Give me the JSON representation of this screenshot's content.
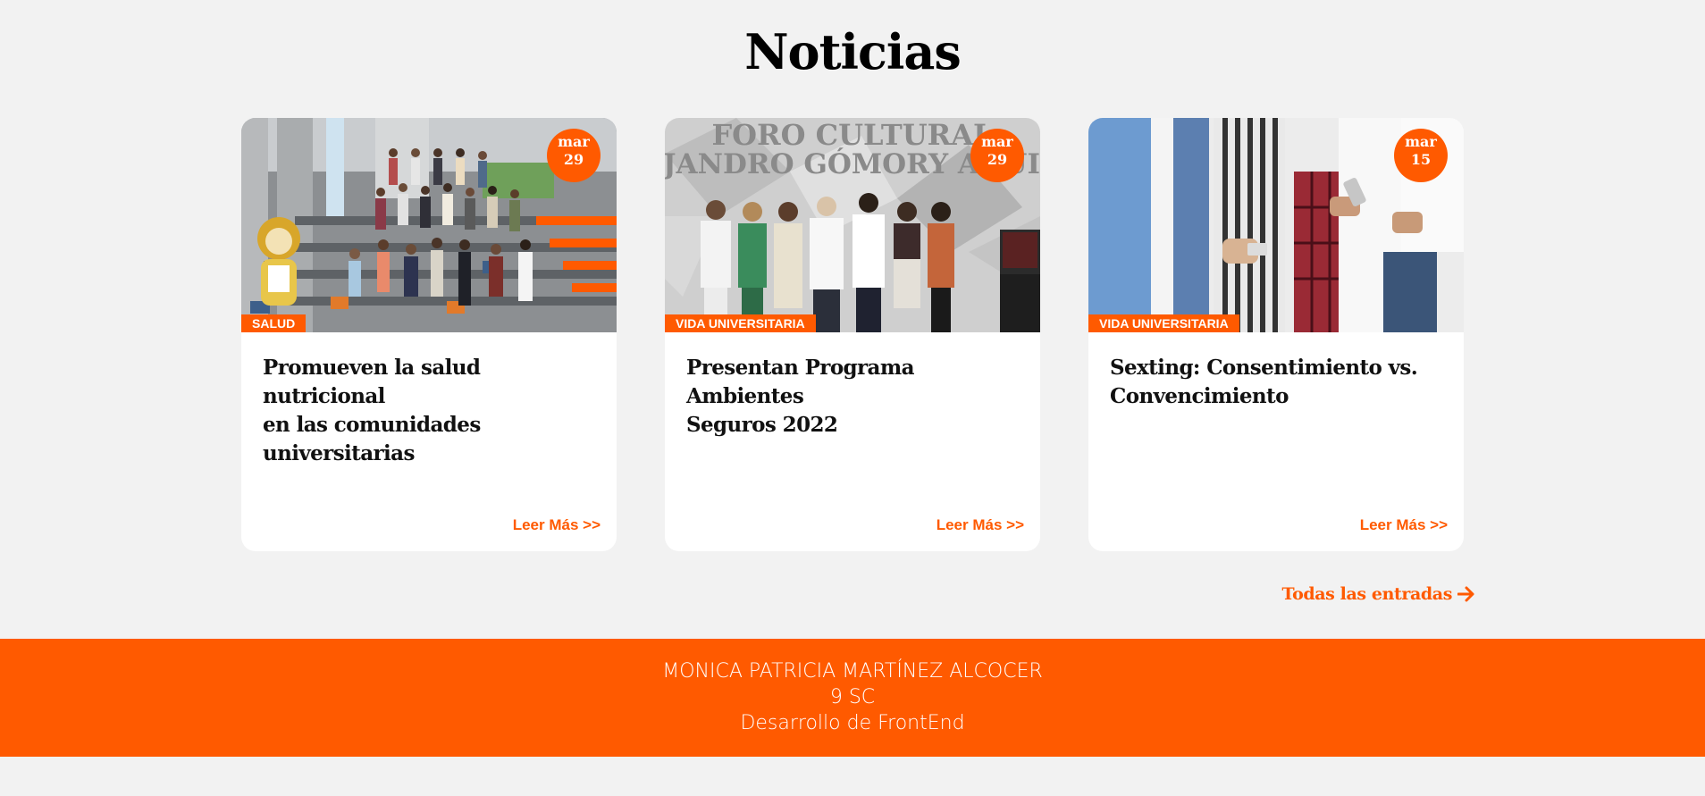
{
  "page": {
    "title": "Noticias"
  },
  "cards": [
    {
      "month": "mar",
      "day": "29",
      "category": "SALUD",
      "title": "Promueven la salud nutricional\nen las comunidades\nuniversitarias",
      "link": "Leer Más >>"
    },
    {
      "month": "mar",
      "day": "29",
      "category": "VIDA UNIVERSITARIA",
      "title": "Presentan Programa\nAmbientes\nSeguros 2022",
      "image_text": "FORO CULTURAL\nALEJANDRO GÓMORY AGUILAR",
      "link": "Leer Más >>"
    },
    {
      "month": "mar",
      "day": "15",
      "category": "VIDA UNIVERSITARIA",
      "title": "Sexting: Consentimiento vs.\nConvencimiento",
      "link": "Leer Más >>"
    }
  ],
  "all_entries": {
    "label": "Todas las entradas",
    "icon": "arrow-right-icon"
  },
  "footer": {
    "name": "MONICA PATRICIA MARTÍNEZ ALCOCER",
    "group": "9 SC",
    "course": "Desarrollo de FrontEnd"
  },
  "colors": {
    "accent": "#ff5a00",
    "background": "#f2f2f2",
    "card": "#ffffff"
  }
}
